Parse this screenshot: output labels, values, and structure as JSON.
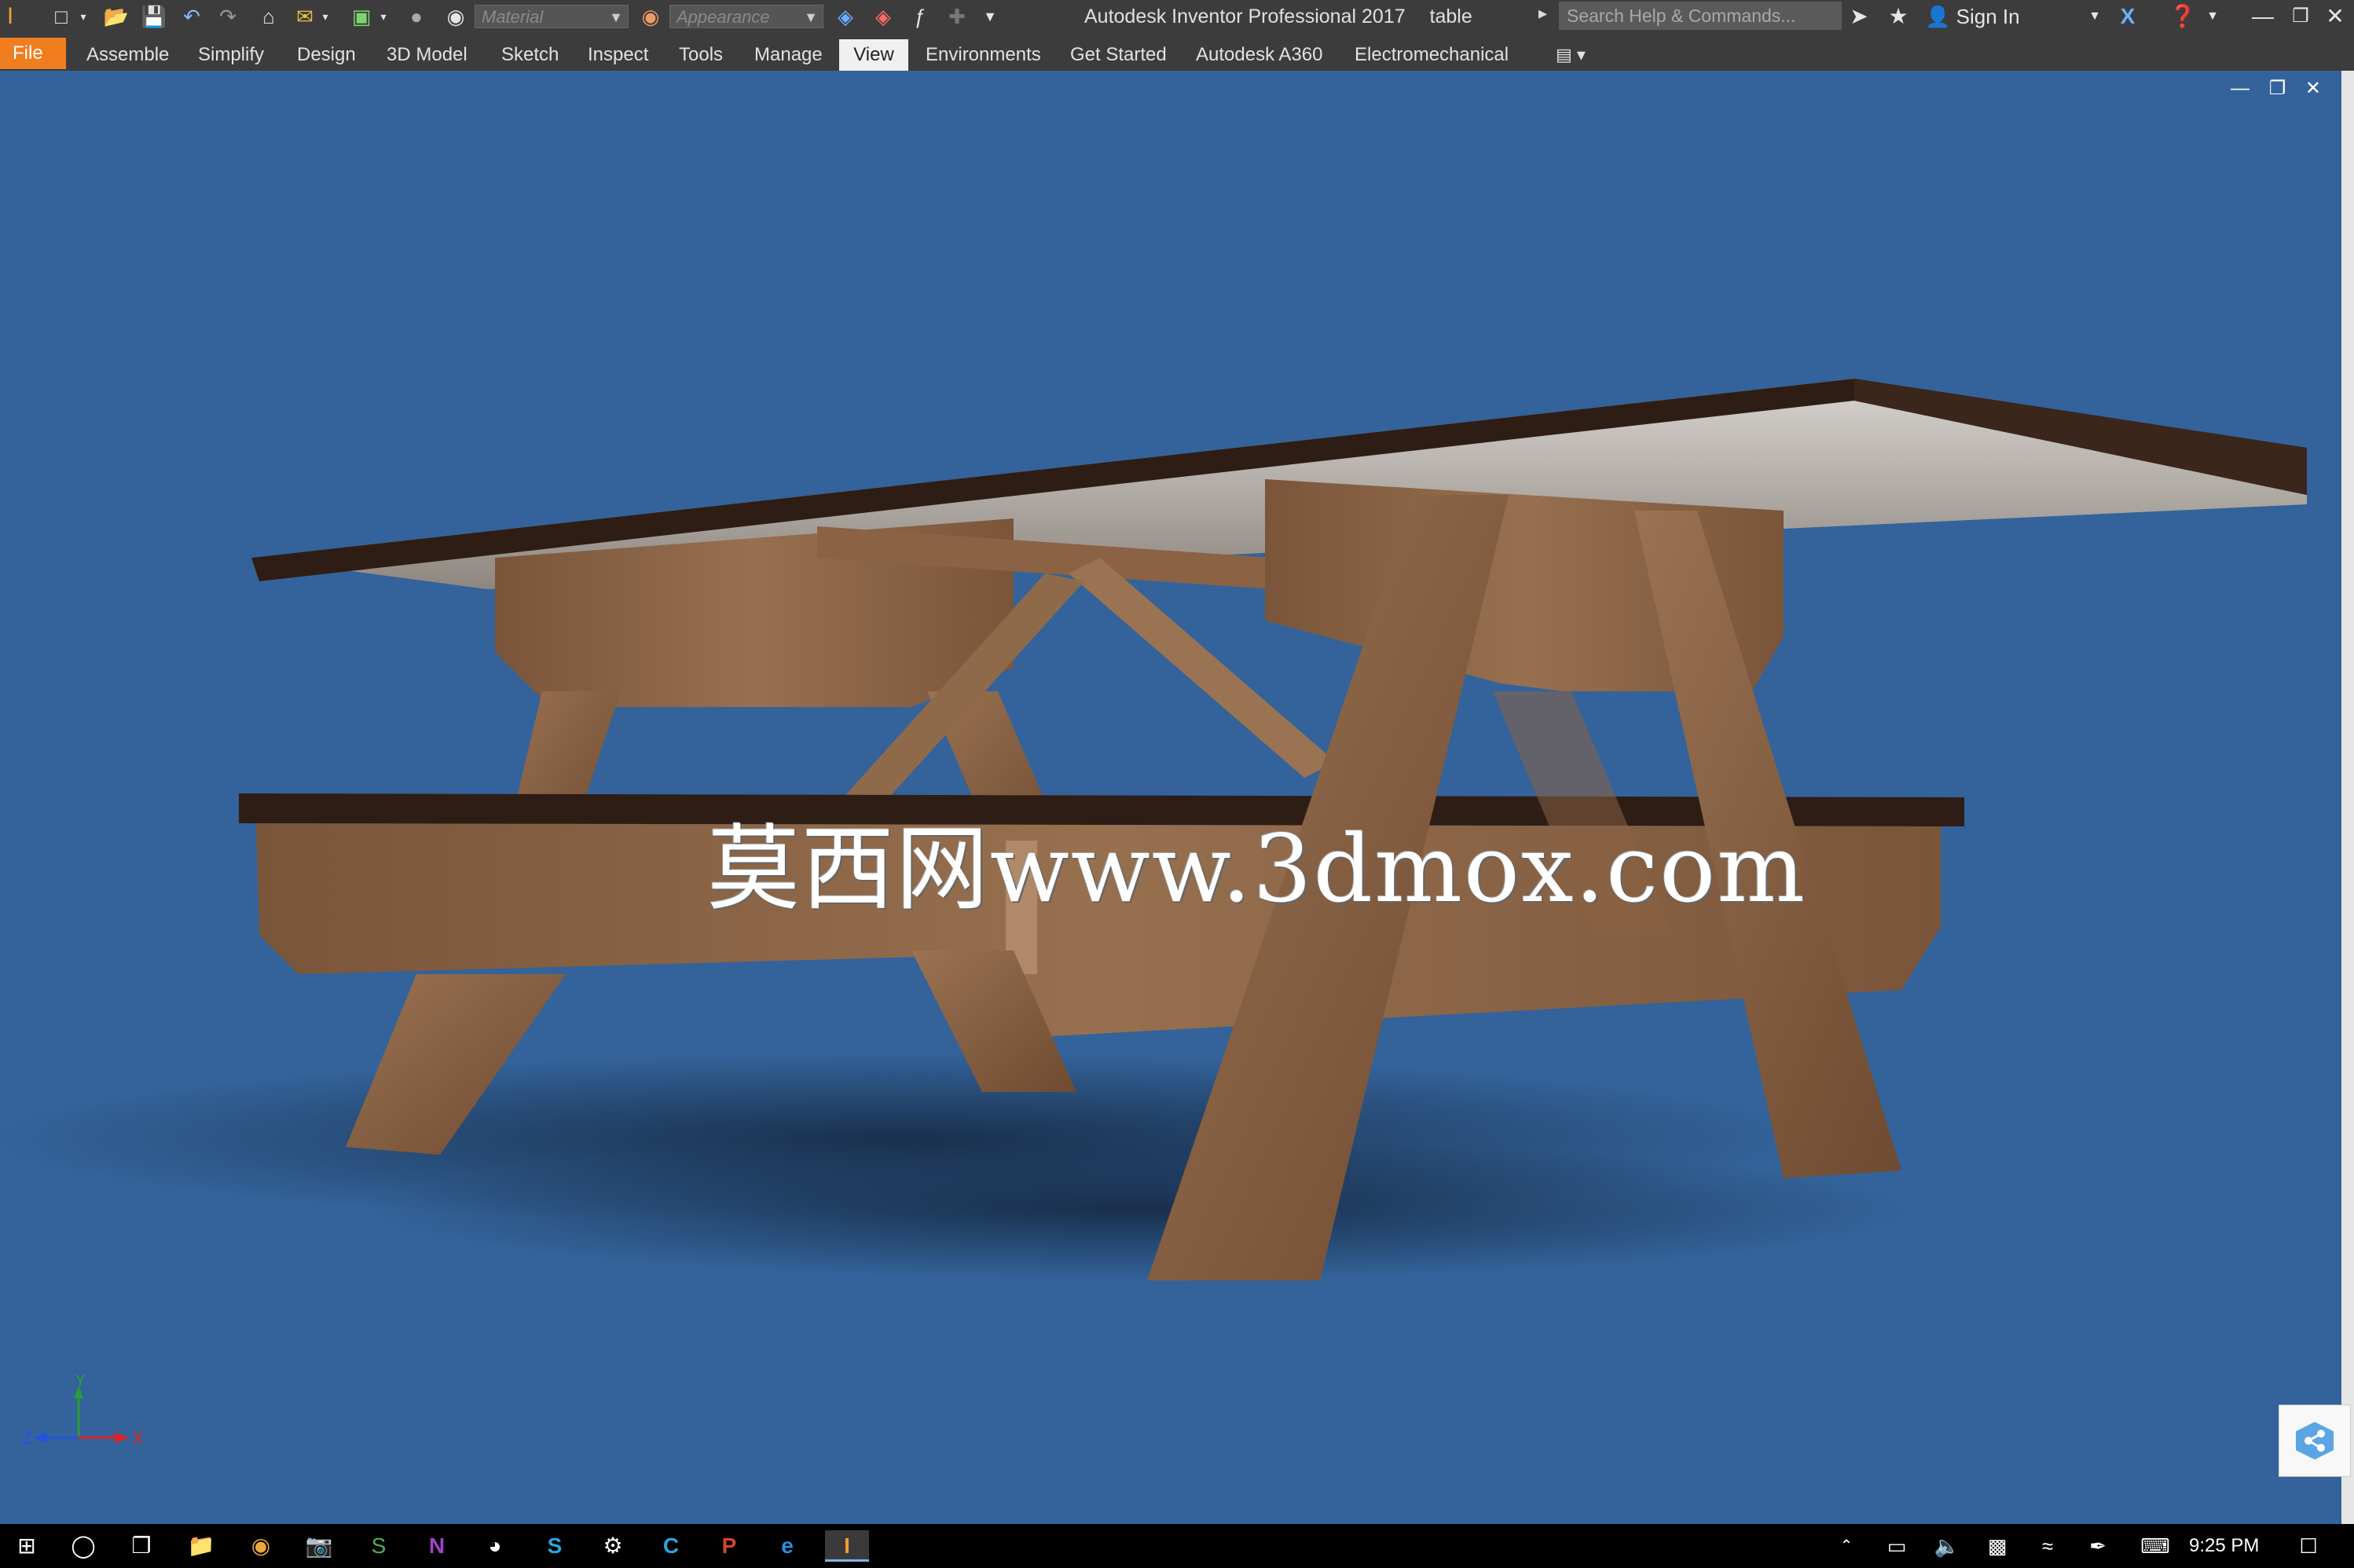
{
  "window": {
    "app_title": "Autodesk Inventor Professional 2017",
    "document_title": "table"
  },
  "quick_access": {
    "material_placeholder": "Material",
    "appearance_placeholder": "Appearance"
  },
  "search": {
    "placeholder": "Search Help & Commands..."
  },
  "account": {
    "sign_in_label": "Sign In"
  },
  "ribbon": {
    "tabs": [
      {
        "label": "File"
      },
      {
        "label": "Assemble"
      },
      {
        "label": "Simplify"
      },
      {
        "label": "Design"
      },
      {
        "label": "3D Model"
      },
      {
        "label": "Sketch"
      },
      {
        "label": "Inspect"
      },
      {
        "label": "Tools"
      },
      {
        "label": "Manage"
      },
      {
        "label": "View"
      },
      {
        "label": "Environments"
      },
      {
        "label": "Get Started"
      },
      {
        "label": "Autodesk A360"
      },
      {
        "label": "Electromechanical"
      }
    ],
    "active_tab": "View"
  },
  "viewport": {
    "watermark": "莫西网www.3dmox.com",
    "axis_labels": {
      "x": "X",
      "y": "Y",
      "z": "Z"
    },
    "background_color": "#33639a"
  },
  "taskbar": {
    "clock": "9:25 PM"
  },
  "colors": {
    "file_tab": "#f07d1e",
    "title_bar": "#3c3c3c",
    "wood": "#8b6244",
    "table_top_edge": "#2e1d15"
  }
}
